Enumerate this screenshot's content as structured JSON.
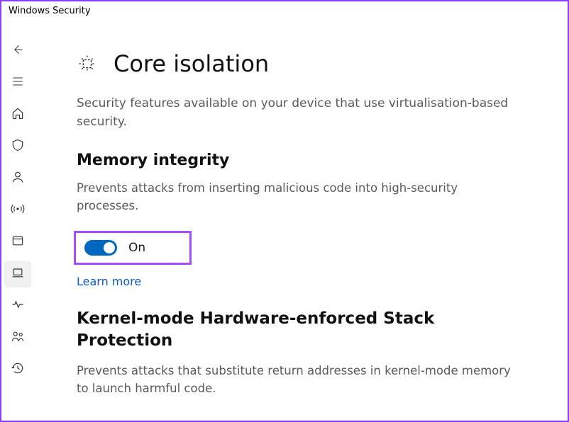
{
  "window_title": "Windows Security",
  "sidebar": {
    "items": [
      {
        "name": "back-button",
        "icon": "arrow-left"
      },
      {
        "name": "menu-button",
        "icon": "hamburger"
      },
      {
        "name": "home-button",
        "icon": "home"
      },
      {
        "name": "virus-protection-button",
        "icon": "shield"
      },
      {
        "name": "account-protection-button",
        "icon": "person"
      },
      {
        "name": "firewall-button",
        "icon": "broadcast"
      },
      {
        "name": "app-browser-control-button",
        "icon": "window"
      },
      {
        "name": "device-security-button",
        "icon": "laptop",
        "active": true
      },
      {
        "name": "device-performance-button",
        "icon": "heartbeat"
      },
      {
        "name": "family-options-button",
        "icon": "family"
      },
      {
        "name": "protection-history-button",
        "icon": "history"
      }
    ]
  },
  "page": {
    "title": "Core isolation",
    "description": "Security features available on your device that use virtualisation-based security."
  },
  "memory_integrity": {
    "title": "Memory integrity",
    "description": "Prevents attacks from inserting malicious code into high-security processes.",
    "toggle_state": "On",
    "learn_more": "Learn more"
  },
  "kernel_stack": {
    "title": "Kernel-mode Hardware-enforced Stack Protection",
    "description": "Prevents attacks that substitute return addresses in kernel-mode memory to launch harmful code."
  },
  "colors": {
    "accent": "#0067c0",
    "link": "#0b5cc4",
    "highlight_border": "#a64dff"
  }
}
